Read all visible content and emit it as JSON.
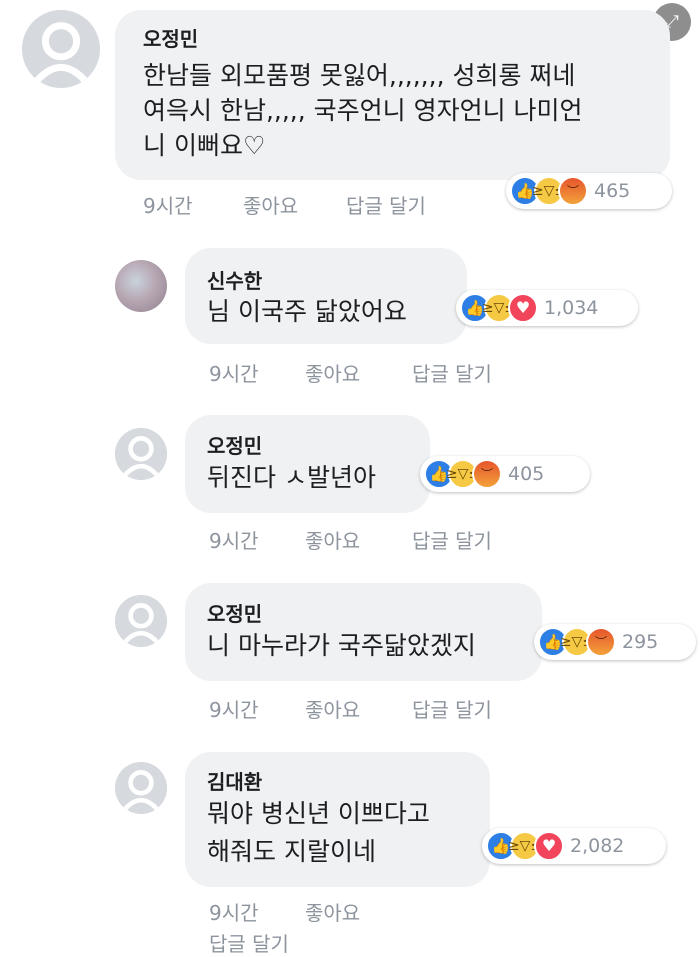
{
  "comments": [
    {
      "author": "오정민",
      "lines": [
        "한남들 외모품평 못잃어,,,,,,, 성희롱 쩌네",
        "여윽시 한남,,,,, 국주언니 영자언니 나미언",
        "니 이뻐요♡"
      ],
      "time": "9시간",
      "like_label": "좋아요",
      "reply_label": "답글 달기",
      "reactions": [
        "like",
        "haha",
        "angry"
      ],
      "reaction_count": "465"
    },
    {
      "author": "신수한",
      "lines": [
        "님 이국주 닮았어요"
      ],
      "time": "9시간",
      "like_label": "좋아요",
      "reply_label": "답글 달기",
      "reactions": [
        "like",
        "haha",
        "love"
      ],
      "reaction_count": "1,034"
    },
    {
      "author": "오정민",
      "lines": [
        "뒤진다 ㅅ발년아"
      ],
      "time": "9시간",
      "like_label": "좋아요",
      "reply_label": "답글 달기",
      "reactions": [
        "like",
        "haha",
        "angry"
      ],
      "reaction_count": "405"
    },
    {
      "author": "오정민",
      "lines": [
        "니 마누라가 국주닮았겠지"
      ],
      "time": "9시간",
      "like_label": "좋아요",
      "reply_label": "답글 달기",
      "reactions": [
        "like",
        "haha",
        "angry"
      ],
      "reaction_count": "295"
    },
    {
      "author": "김대환",
      "lines": [
        "뭐야 병신년 이쁘다고",
        "해줘도 지랄이네"
      ],
      "time": "9시간",
      "like_label": "좋아요",
      "reply_label": "답글 달기",
      "reactions": [
        "like",
        "haha",
        "love"
      ],
      "reaction_count": "2,082"
    }
  ],
  "icons": {
    "expand": "expand-icon",
    "like": "thumbs-up-icon",
    "haha": "laughing-face-icon",
    "angry": "angry-face-icon",
    "love": "heart-icon",
    "avatar": "default-profile-icon"
  },
  "colors": {
    "bubble": "#eff1f3",
    "meta_text": "#8d949e",
    "like_blue": "#2d7fe6",
    "haha_yellow": "#f6c945",
    "angry_orange": "#e7552c",
    "love_red": "#f2445a"
  }
}
